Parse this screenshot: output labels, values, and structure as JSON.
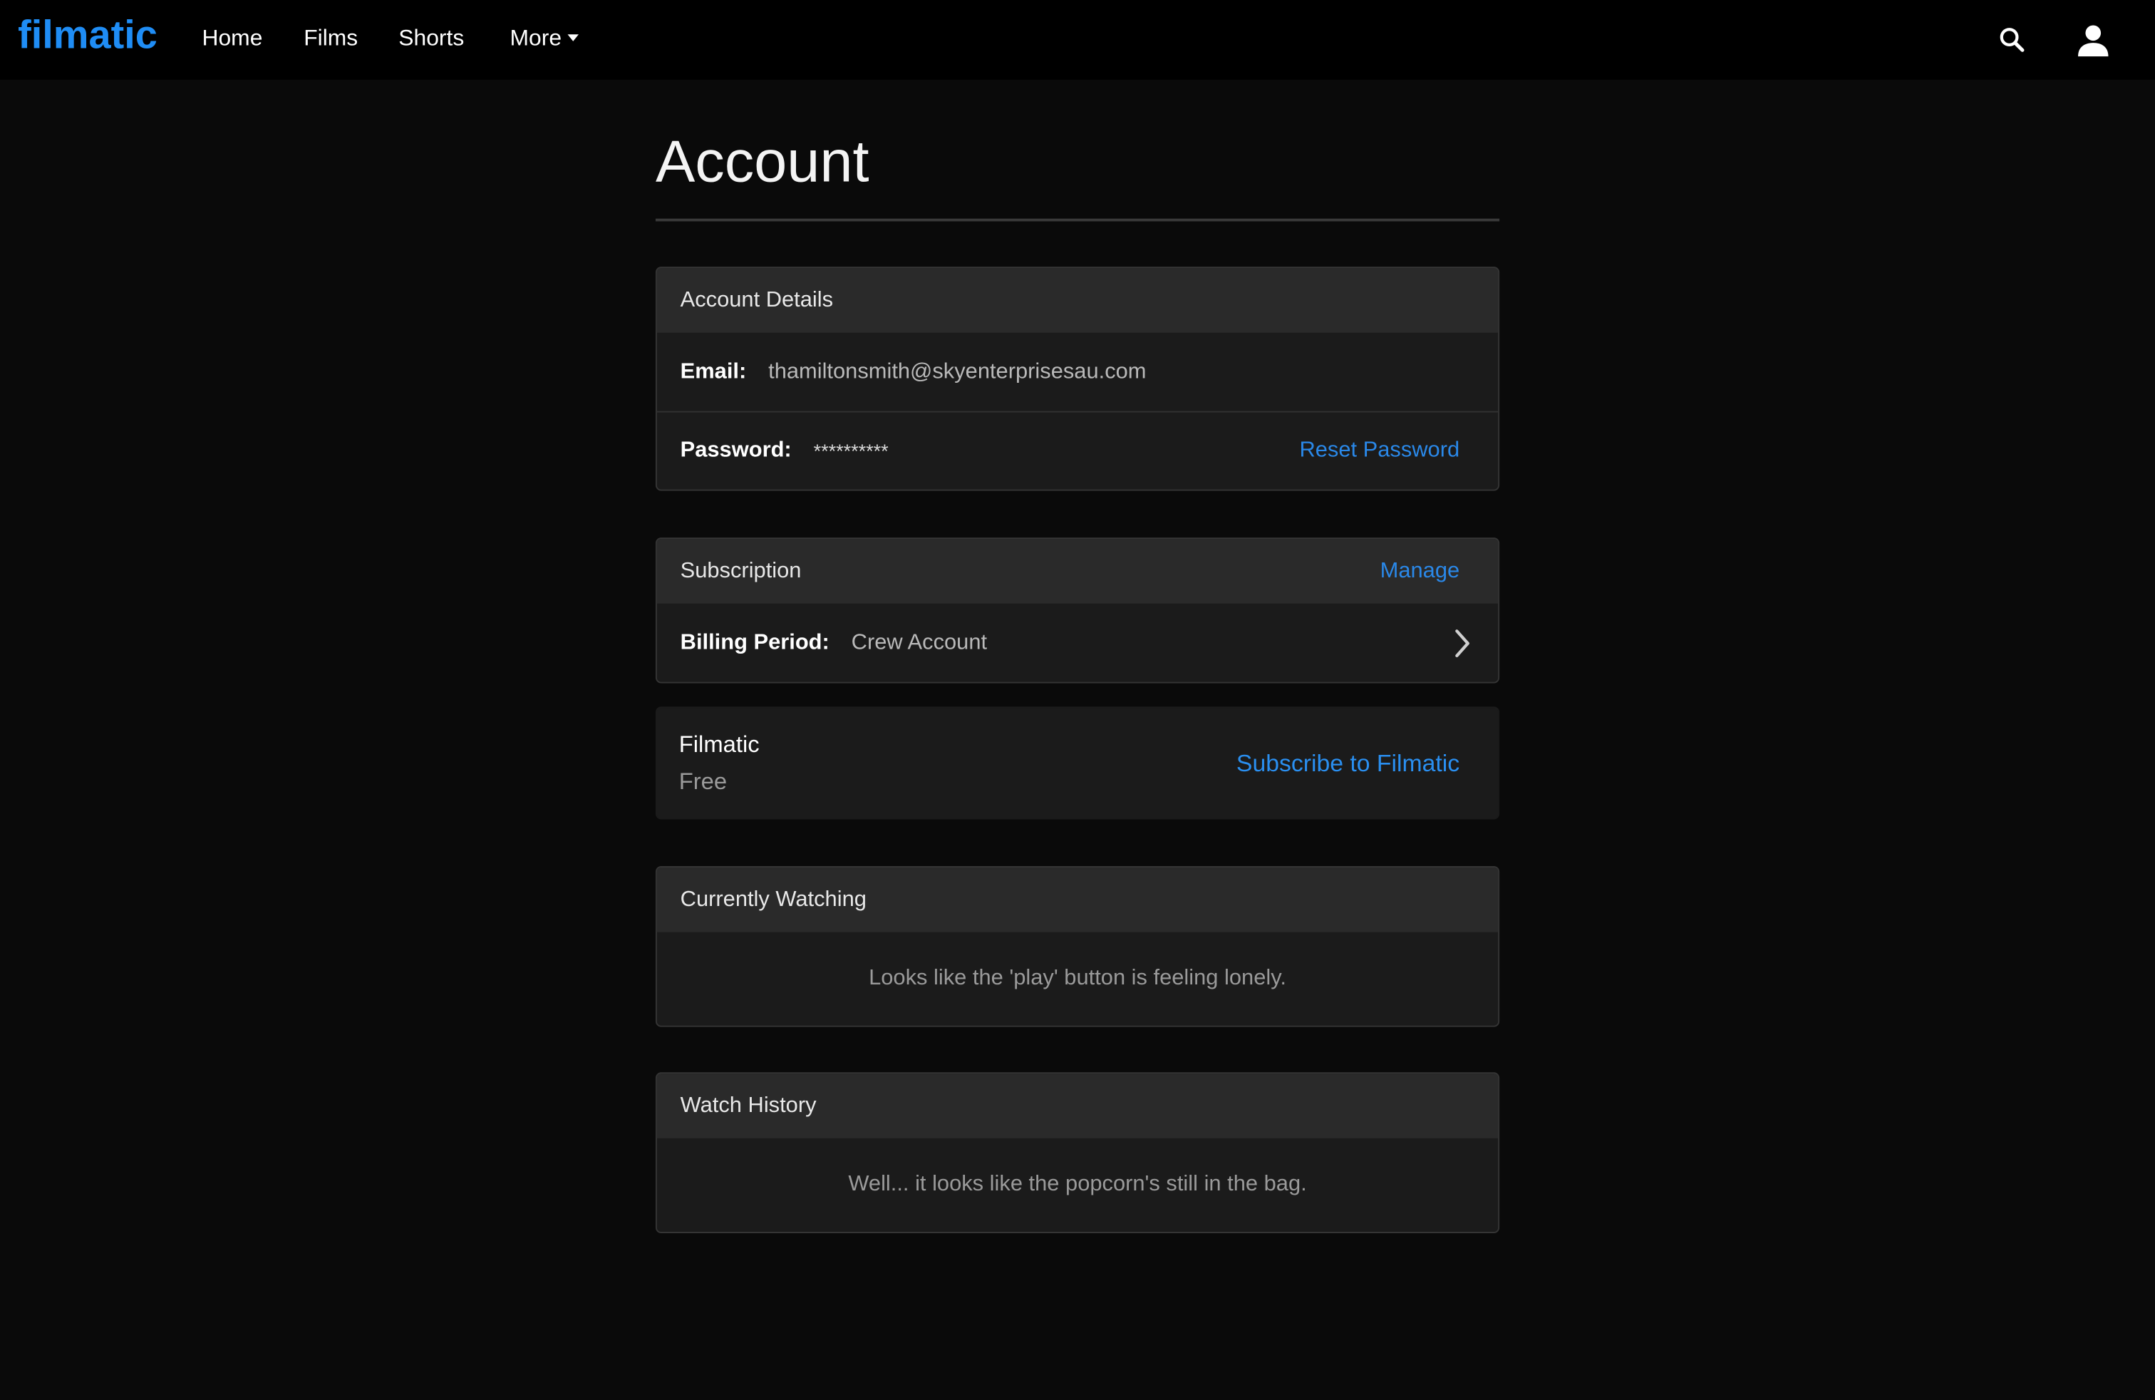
{
  "nav": {
    "logo": "filmatic",
    "links": [
      "Home",
      "Films",
      "Shorts",
      "More"
    ],
    "search_icon": "search-icon",
    "user_icon": "user-icon"
  },
  "page": {
    "title": "Account"
  },
  "account_details": {
    "header": "Account Details",
    "email_label": "Email:",
    "email_value": "thamiltonsmith@skyenterprisesau.com",
    "password_label": "Password:",
    "password_value": "**********",
    "reset_password": "Reset Password"
  },
  "subscription": {
    "header": "Subscription",
    "manage": "Manage",
    "billing_label": "Billing Period:",
    "billing_value": "Crew Account"
  },
  "plan": {
    "name": "Filmatic",
    "tier": "Free",
    "subscribe": "Subscribe to Filmatic"
  },
  "currently_watching": {
    "header": "Currently Watching",
    "empty_message": "Looks like the 'play' button is feeling lonely."
  },
  "watch_history": {
    "header": "Watch History",
    "empty_message": "Well... it looks like the popcorn's still in the bag."
  },
  "colors": {
    "accent": "#1f8df5",
    "link": "#2a88e8",
    "background": "#0a0a0a",
    "card": "#1b1b1b",
    "card_header": "#2a2a2a"
  }
}
